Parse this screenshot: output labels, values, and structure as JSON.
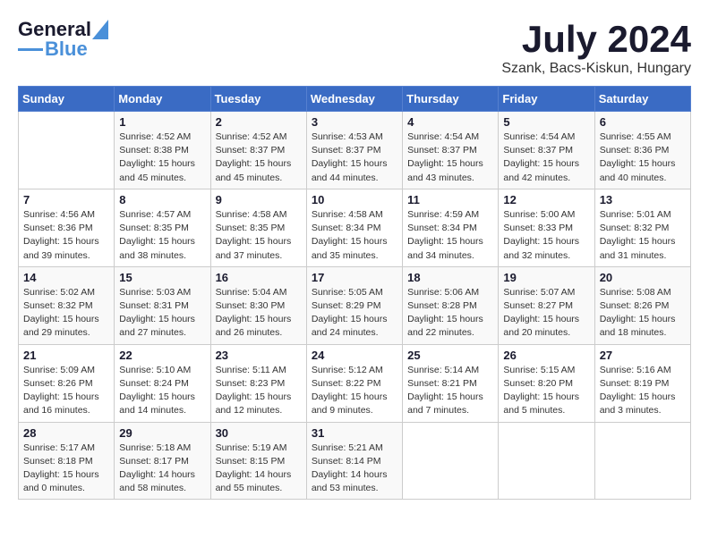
{
  "header": {
    "logo_general": "General",
    "logo_blue": "Blue",
    "title": "July 2024",
    "location": "Szank, Bacs-Kiskun, Hungary"
  },
  "columns": [
    "Sunday",
    "Monday",
    "Tuesday",
    "Wednesday",
    "Thursday",
    "Friday",
    "Saturday"
  ],
  "weeks": [
    [
      {
        "day": "",
        "info": ""
      },
      {
        "day": "1",
        "info": "Sunrise: 4:52 AM\nSunset: 8:38 PM\nDaylight: 15 hours\nand 45 minutes."
      },
      {
        "day": "2",
        "info": "Sunrise: 4:52 AM\nSunset: 8:37 PM\nDaylight: 15 hours\nand 45 minutes."
      },
      {
        "day": "3",
        "info": "Sunrise: 4:53 AM\nSunset: 8:37 PM\nDaylight: 15 hours\nand 44 minutes."
      },
      {
        "day": "4",
        "info": "Sunrise: 4:54 AM\nSunset: 8:37 PM\nDaylight: 15 hours\nand 43 minutes."
      },
      {
        "day": "5",
        "info": "Sunrise: 4:54 AM\nSunset: 8:37 PM\nDaylight: 15 hours\nand 42 minutes."
      },
      {
        "day": "6",
        "info": "Sunrise: 4:55 AM\nSunset: 8:36 PM\nDaylight: 15 hours\nand 40 minutes."
      }
    ],
    [
      {
        "day": "7",
        "info": "Sunrise: 4:56 AM\nSunset: 8:36 PM\nDaylight: 15 hours\nand 39 minutes."
      },
      {
        "day": "8",
        "info": "Sunrise: 4:57 AM\nSunset: 8:35 PM\nDaylight: 15 hours\nand 38 minutes."
      },
      {
        "day": "9",
        "info": "Sunrise: 4:58 AM\nSunset: 8:35 PM\nDaylight: 15 hours\nand 37 minutes."
      },
      {
        "day": "10",
        "info": "Sunrise: 4:58 AM\nSunset: 8:34 PM\nDaylight: 15 hours\nand 35 minutes."
      },
      {
        "day": "11",
        "info": "Sunrise: 4:59 AM\nSunset: 8:34 PM\nDaylight: 15 hours\nand 34 minutes."
      },
      {
        "day": "12",
        "info": "Sunrise: 5:00 AM\nSunset: 8:33 PM\nDaylight: 15 hours\nand 32 minutes."
      },
      {
        "day": "13",
        "info": "Sunrise: 5:01 AM\nSunset: 8:32 PM\nDaylight: 15 hours\nand 31 minutes."
      }
    ],
    [
      {
        "day": "14",
        "info": "Sunrise: 5:02 AM\nSunset: 8:32 PM\nDaylight: 15 hours\nand 29 minutes."
      },
      {
        "day": "15",
        "info": "Sunrise: 5:03 AM\nSunset: 8:31 PM\nDaylight: 15 hours\nand 27 minutes."
      },
      {
        "day": "16",
        "info": "Sunrise: 5:04 AM\nSunset: 8:30 PM\nDaylight: 15 hours\nand 26 minutes."
      },
      {
        "day": "17",
        "info": "Sunrise: 5:05 AM\nSunset: 8:29 PM\nDaylight: 15 hours\nand 24 minutes."
      },
      {
        "day": "18",
        "info": "Sunrise: 5:06 AM\nSunset: 8:28 PM\nDaylight: 15 hours\nand 22 minutes."
      },
      {
        "day": "19",
        "info": "Sunrise: 5:07 AM\nSunset: 8:27 PM\nDaylight: 15 hours\nand 20 minutes."
      },
      {
        "day": "20",
        "info": "Sunrise: 5:08 AM\nSunset: 8:26 PM\nDaylight: 15 hours\nand 18 minutes."
      }
    ],
    [
      {
        "day": "21",
        "info": "Sunrise: 5:09 AM\nSunset: 8:26 PM\nDaylight: 15 hours\nand 16 minutes."
      },
      {
        "day": "22",
        "info": "Sunrise: 5:10 AM\nSunset: 8:24 PM\nDaylight: 15 hours\nand 14 minutes."
      },
      {
        "day": "23",
        "info": "Sunrise: 5:11 AM\nSunset: 8:23 PM\nDaylight: 15 hours\nand 12 minutes."
      },
      {
        "day": "24",
        "info": "Sunrise: 5:12 AM\nSunset: 8:22 PM\nDaylight: 15 hours\nand 9 minutes."
      },
      {
        "day": "25",
        "info": "Sunrise: 5:14 AM\nSunset: 8:21 PM\nDaylight: 15 hours\nand 7 minutes."
      },
      {
        "day": "26",
        "info": "Sunrise: 5:15 AM\nSunset: 8:20 PM\nDaylight: 15 hours\nand 5 minutes."
      },
      {
        "day": "27",
        "info": "Sunrise: 5:16 AM\nSunset: 8:19 PM\nDaylight: 15 hours\nand 3 minutes."
      }
    ],
    [
      {
        "day": "28",
        "info": "Sunrise: 5:17 AM\nSunset: 8:18 PM\nDaylight: 15 hours\nand 0 minutes."
      },
      {
        "day": "29",
        "info": "Sunrise: 5:18 AM\nSunset: 8:17 PM\nDaylight: 14 hours\nand 58 minutes."
      },
      {
        "day": "30",
        "info": "Sunrise: 5:19 AM\nSunset: 8:15 PM\nDaylight: 14 hours\nand 55 minutes."
      },
      {
        "day": "31",
        "info": "Sunrise: 5:21 AM\nSunset: 8:14 PM\nDaylight: 14 hours\nand 53 minutes."
      },
      {
        "day": "",
        "info": ""
      },
      {
        "day": "",
        "info": ""
      },
      {
        "day": "",
        "info": ""
      }
    ]
  ]
}
